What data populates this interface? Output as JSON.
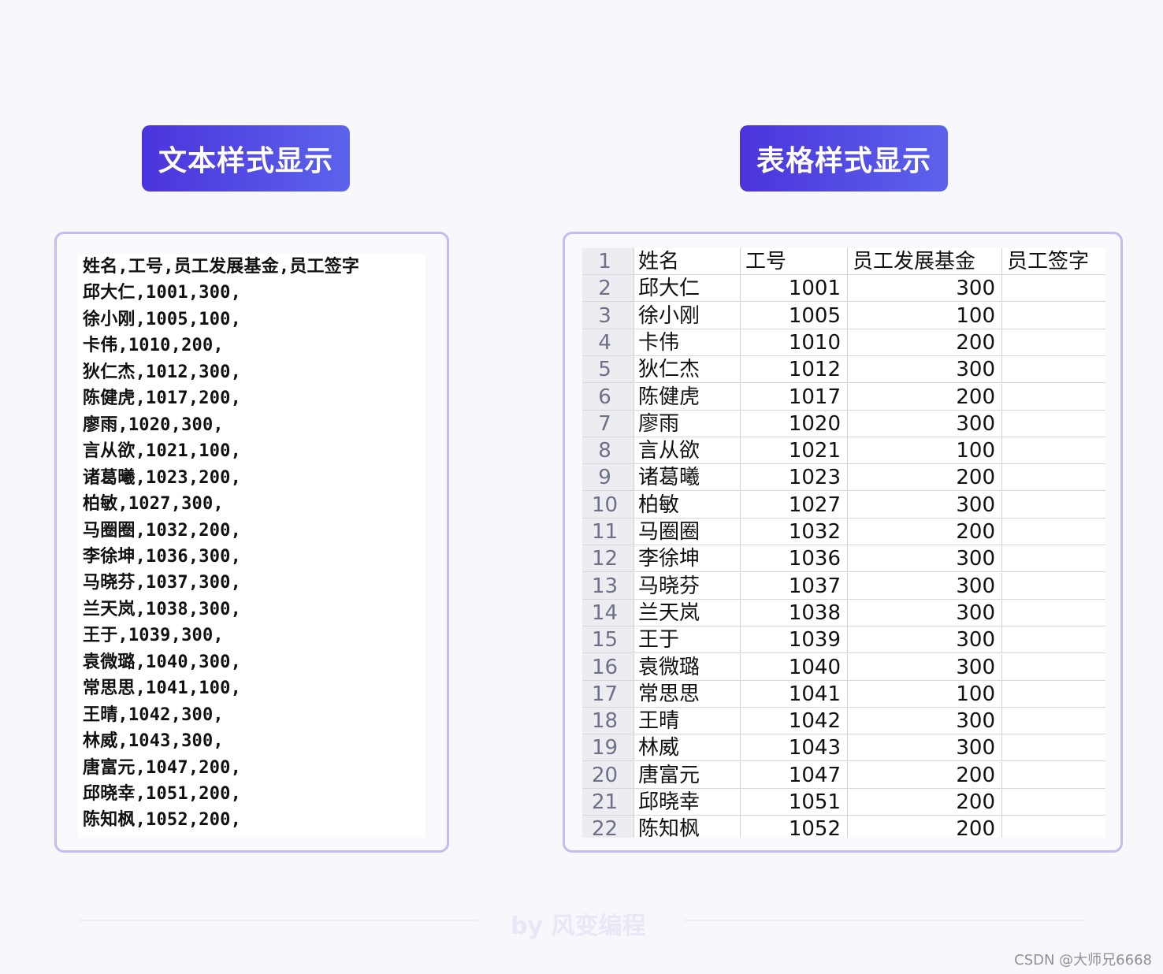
{
  "badges": {
    "text_view": "文本样式显示",
    "table_view": "表格样式显示"
  },
  "text_lines": [
    "姓名,工号,员工发展基金,员工签字",
    "邱大仁,1001,300,",
    "徐小刚,1005,100,",
    "卡伟,1010,200,",
    "狄仁杰,1012,300,",
    "陈健虎,1017,200,",
    "廖雨,1020,300,",
    "言从欲,1021,100,",
    "诸葛曦,1023,200,",
    "柏敏,1027,300,",
    "马圈圈,1032,200,",
    "李徐坤,1036,300,",
    "马晓芬,1037,300,",
    "兰天岚,1038,300,",
    "王于,1039,300,",
    "袁微璐,1040,300,",
    "常思思,1041,100,",
    "王晴,1042,300,",
    "林威,1043,300,",
    "唐富元,1047,200,",
    "邱晓幸,1051,200,",
    "陈知枫,1052,200,"
  ],
  "table": {
    "rows": [
      {
        "num": "1",
        "name": "姓名",
        "id": "工号",
        "fund": "员工发展基金",
        "sign": "员工签字"
      },
      {
        "num": "2",
        "name": "邱大仁",
        "id": "1001",
        "fund": "300",
        "sign": ""
      },
      {
        "num": "3",
        "name": "徐小刚",
        "id": "1005",
        "fund": "100",
        "sign": ""
      },
      {
        "num": "4",
        "name": "卡伟",
        "id": "1010",
        "fund": "200",
        "sign": ""
      },
      {
        "num": "5",
        "name": "狄仁杰",
        "id": "1012",
        "fund": "300",
        "sign": ""
      },
      {
        "num": "6",
        "name": "陈健虎",
        "id": "1017",
        "fund": "200",
        "sign": ""
      },
      {
        "num": "7",
        "name": "廖雨",
        "id": "1020",
        "fund": "300",
        "sign": ""
      },
      {
        "num": "8",
        "name": "言从欲",
        "id": "1021",
        "fund": "100",
        "sign": ""
      },
      {
        "num": "9",
        "name": "诸葛曦",
        "id": "1023",
        "fund": "200",
        "sign": ""
      },
      {
        "num": "10",
        "name": "柏敏",
        "id": "1027",
        "fund": "300",
        "sign": ""
      },
      {
        "num": "11",
        "name": "马圈圈",
        "id": "1032",
        "fund": "200",
        "sign": ""
      },
      {
        "num": "12",
        "name": "李徐坤",
        "id": "1036",
        "fund": "300",
        "sign": ""
      },
      {
        "num": "13",
        "name": "马晓芬",
        "id": "1037",
        "fund": "300",
        "sign": ""
      },
      {
        "num": "14",
        "name": "兰天岚",
        "id": "1038",
        "fund": "300",
        "sign": ""
      },
      {
        "num": "15",
        "name": "王于",
        "id": "1039",
        "fund": "300",
        "sign": ""
      },
      {
        "num": "16",
        "name": "袁微璐",
        "id": "1040",
        "fund": "300",
        "sign": ""
      },
      {
        "num": "17",
        "name": "常思思",
        "id": "1041",
        "fund": "100",
        "sign": ""
      },
      {
        "num": "18",
        "name": "王晴",
        "id": "1042",
        "fund": "300",
        "sign": ""
      },
      {
        "num": "19",
        "name": "林威",
        "id": "1043",
        "fund": "300",
        "sign": ""
      },
      {
        "num": "20",
        "name": "唐富元",
        "id": "1047",
        "fund": "200",
        "sign": ""
      },
      {
        "num": "21",
        "name": "邱晓幸",
        "id": "1051",
        "fund": "200",
        "sign": ""
      },
      {
        "num": "22",
        "name": "陈知枫",
        "id": "1052",
        "fund": "200",
        "sign": ""
      }
    ]
  },
  "footer": {
    "mark": "by 风变编程",
    "watermark": "CSDN @大师兄6668"
  },
  "colors": {
    "badge_gradient_start": "#4b34dc",
    "badge_gradient_end": "#5c63ec",
    "panel_border": "#c3bdf2",
    "background": "#f7f7fc"
  }
}
